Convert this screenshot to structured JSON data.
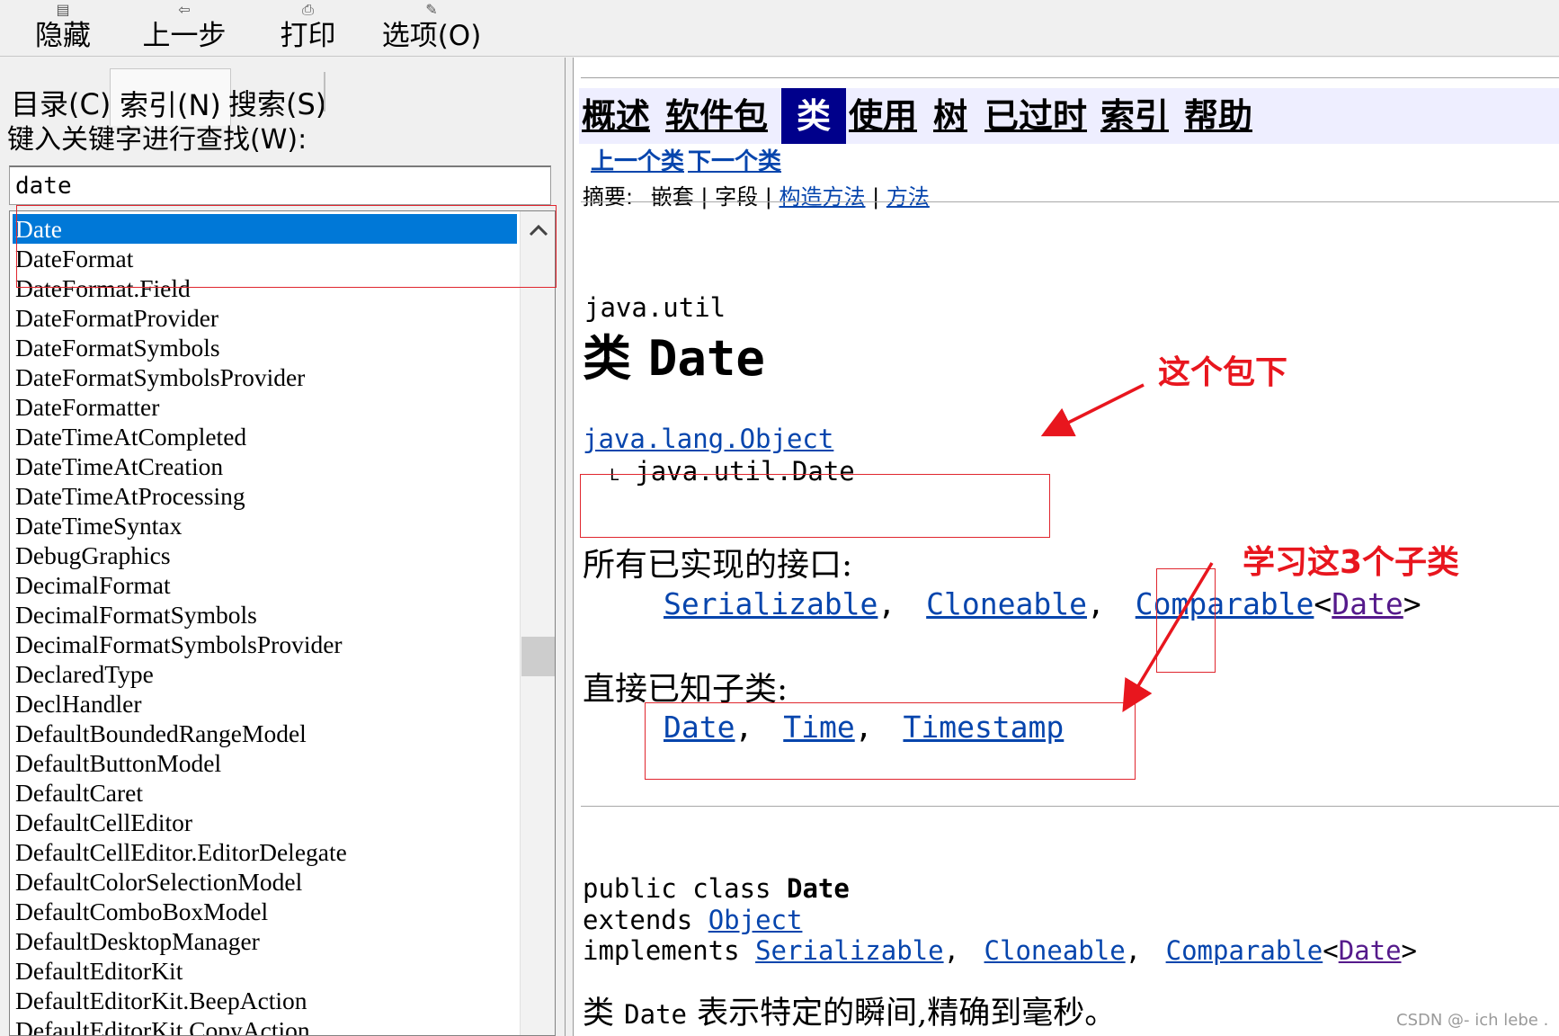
{
  "toolbar": {
    "hide": {
      "label": "隐藏",
      "icon": "hide-icon"
    },
    "back": {
      "label": "上一步",
      "icon": "back-arrow-icon"
    },
    "print": {
      "label": "打印",
      "icon": "printer-icon"
    },
    "options": {
      "label": "选项(O)",
      "icon": "options-icon"
    }
  },
  "left_pane": {
    "tabs": [
      "目录(C)",
      "索引(N)",
      "搜索(S)"
    ],
    "active_tab": "索引(N)",
    "search_label": "键入关键字进行查找(W):",
    "search_value": "date",
    "keywords": [
      "Date",
      "DateFormat",
      "DateFormat.Field",
      "DateFormatProvider",
      "DateFormatSymbols",
      "DateFormatSymbolsProvider",
      "DateFormatter",
      "DateTimeAtCompleted",
      "DateTimeAtCreation",
      "DateTimeAtProcessing",
      "DateTimeSyntax",
      "DebugGraphics",
      "DecimalFormat",
      "DecimalFormatSymbols",
      "DecimalFormatSymbolsProvider",
      "DeclaredType",
      "DeclHandler",
      "DefaultBoundedRangeModel",
      "DefaultButtonModel",
      "DefaultCaret",
      "DefaultCellEditor",
      "DefaultCellEditor.EditorDelegate",
      "DefaultColorSelectionModel",
      "DefaultComboBoxModel",
      "DefaultDesktopManager",
      "DefaultEditorKit",
      "DefaultEditorKit.BeepAction",
      "DefaultEditorKit.CopyAction"
    ],
    "selected_keyword": "Date"
  },
  "doc": {
    "nav": [
      "概述",
      "软件包",
      "类",
      "使用",
      "树",
      "已过时",
      "索引",
      "帮助"
    ],
    "nav_current": "类",
    "prev_class": "上一个类",
    "next_class": "下一个类",
    "summary": {
      "label": "摘要:",
      "nested": "嵌套",
      "sep": "|",
      "field": "字段",
      "constructor": "构造方法",
      "method": "方法"
    },
    "package": "java.util",
    "class_kind": "类",
    "class_name": "Date",
    "parent_class": "java.lang.Object",
    "tree_marker": "L",
    "child_class": "java.util.Date",
    "interfaces_heading": "所有已实现的接口:",
    "interfaces": [
      "Serializable",
      "Cloneable",
      "Comparable",
      "Date"
    ],
    "subclasses_heading": "直接已知子类:",
    "subclasses": [
      "Date",
      "Time",
      "Timestamp"
    ],
    "comma": ",",
    "lt": "<",
    "gt": ">",
    "declaration": {
      "public_class": "public class",
      "name": "Date",
      "extends": "extends",
      "object": "Object",
      "implements": "implements",
      "impl_list": [
        "Serializable",
        "Cloneable",
        "Comparable",
        "Date"
      ]
    },
    "description": {
      "kind": "类",
      "name": "Date",
      "text": "表示特定的瞬间,精确到毫秒。"
    }
  },
  "annotations": {
    "package_note": "这个包下",
    "subclass_note": "学习这3个子类",
    "color": "#e8161e"
  },
  "watermark": "CSDN @- ich lebe ."
}
